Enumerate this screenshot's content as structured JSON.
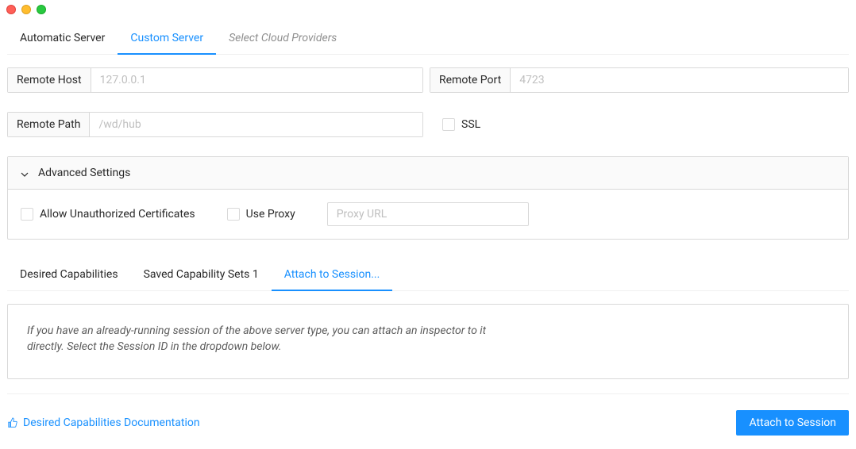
{
  "server_tabs": {
    "automatic": "Automatic Server",
    "custom": "Custom Server",
    "cloud": "Select Cloud Providers"
  },
  "fields": {
    "remote_host_label": "Remote Host",
    "remote_host_placeholder": "127.0.0.1",
    "remote_port_label": "Remote Port",
    "remote_port_placeholder": "4723",
    "remote_path_label": "Remote Path",
    "remote_path_placeholder": "/wd/hub",
    "ssl_label": "SSL"
  },
  "advanced": {
    "title": "Advanced Settings",
    "allow_unauthorized": "Allow Unauthorized Certificates",
    "use_proxy": "Use Proxy",
    "proxy_url_placeholder": "Proxy URL"
  },
  "session_tabs": {
    "desired": "Desired Capabilities",
    "saved": "Saved Capability Sets 1",
    "attach": "Attach to Session..."
  },
  "attach_panel": {
    "description": "If you have an already-running session of the above server type, you can attach an inspector to it directly. Select the Session ID in the dropdown below."
  },
  "footer": {
    "doc_link": "Desired Capabilities Documentation",
    "attach_btn": "Attach to Session"
  }
}
